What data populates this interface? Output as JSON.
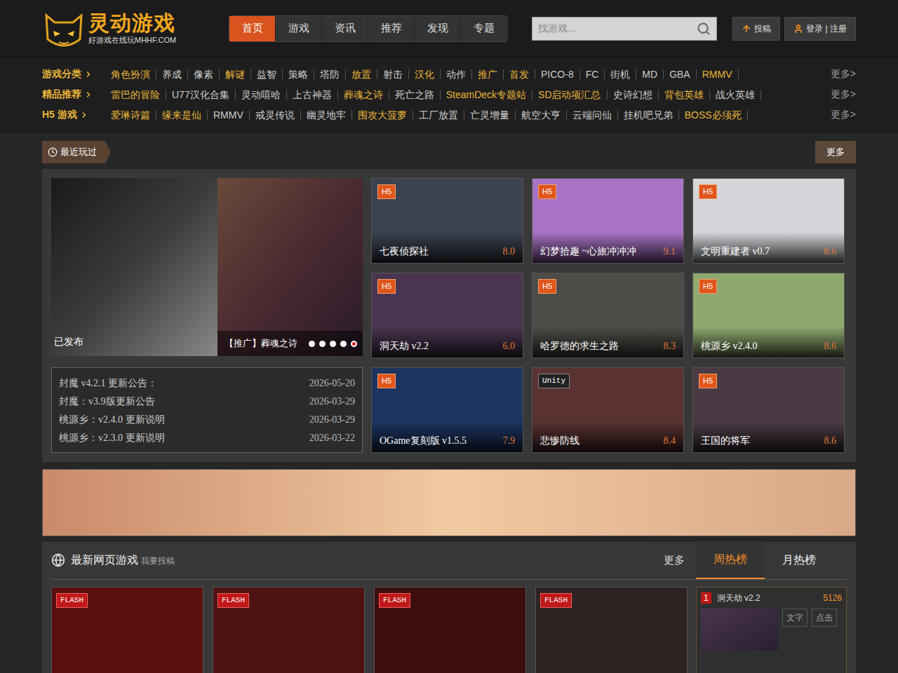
{
  "header": {
    "logo": {
      "title": "灵动游戏",
      "subtitle": "好游戏在线玩MHHF.COM"
    },
    "nav": [
      {
        "label": "首页",
        "selected": true
      },
      {
        "label": "游戏",
        "selected": false
      },
      {
        "label": "资讯",
        "selected": false
      },
      {
        "label": "推荐",
        "selected": false
      },
      {
        "label": "发现",
        "selected": false
      },
      {
        "label": "专题",
        "selected": false
      }
    ],
    "search": {
      "placeholder": "找游戏..."
    },
    "actions": [
      {
        "label": "投稿",
        "kind": "submit"
      },
      {
        "label": "登录 | 注册",
        "kind": "login"
      }
    ]
  },
  "categories": [
    {
      "label": "游戏分类",
      "more": "更多>",
      "items": [
        {
          "label": "角色扮演",
          "color": "#e8b53a"
        },
        {
          "label": "养成",
          "color": "#cccccc"
        },
        {
          "label": "像素",
          "color": "#cccccc"
        },
        {
          "label": "解谜",
          "color": "#e8b53a"
        },
        {
          "label": "益智",
          "color": "#cccccc"
        },
        {
          "label": "策略",
          "color": "#cccccc"
        },
        {
          "label": "塔防",
          "color": "#cccccc"
        },
        {
          "label": "放置",
          "color": "#e8b53a"
        },
        {
          "label": "射击",
          "color": "#cccccc"
        },
        {
          "label": "汉化",
          "color": "#e8b53a"
        },
        {
          "label": "动作",
          "color": "#cccccc"
        },
        {
          "label": "推广",
          "color": "#e8b53a"
        },
        {
          "label": "首发",
          "color": "#e8b53a"
        },
        {
          "label": "PICO-8",
          "color": "#cccccc"
        },
        {
          "label": "FC",
          "color": "#cccccc"
        },
        {
          "label": "街机",
          "color": "#cccccc"
        },
        {
          "label": "MD",
          "color": "#cccccc"
        },
        {
          "label": "GBA",
          "color": "#cccccc"
        },
        {
          "label": "RMMV",
          "color": "#e8b53a"
        }
      ]
    },
    {
      "label": "精品推荐",
      "more": "更多>",
      "items": [
        {
          "label": "雷巴的冒险",
          "color": "#e8b53a"
        },
        {
          "label": "U77汉化合集",
          "color": "#cccccc"
        },
        {
          "label": "灵动嘻哈",
          "color": "#cccccc"
        },
        {
          "label": "上古神器",
          "color": "#cccccc"
        },
        {
          "label": "葬魂之诗",
          "color": "#e8b53a"
        },
        {
          "label": "死亡之路",
          "color": "#cccccc"
        },
        {
          "label": "SteamDeck专题站",
          "color": "#e8b53a"
        },
        {
          "label": "SD启动项汇总",
          "color": "#e8b53a"
        },
        {
          "label": "史诗幻想",
          "color": "#cccccc"
        },
        {
          "label": "背包英雄",
          "color": "#e8b53a"
        },
        {
          "label": "战火英雄",
          "color": "#cccccc"
        }
      ]
    },
    {
      "label": "H5 游戏",
      "more": "更多>",
      "items": [
        {
          "label": "爱琳诗篇",
          "color": "#e8b53a"
        },
        {
          "label": "缘来是仙",
          "color": "#e8b53a"
        },
        {
          "label": "RMMV",
          "color": "#cccccc"
        },
        {
          "label": "戒灵传说",
          "color": "#cccccc"
        },
        {
          "label": "幽灵地牢",
          "color": "#cccccc"
        },
        {
          "label": "围攻大菠萝",
          "color": "#e8b53a"
        },
        {
          "label": "工厂放置",
          "color": "#cccccc"
        },
        {
          "label": "亡灵增量",
          "color": "#cccccc"
        },
        {
          "label": "航空大亨",
          "color": "#cccccc"
        },
        {
          "label": "云端问仙",
          "color": "#cccccc"
        },
        {
          "label": "挂机吧兄弟",
          "color": "#cccccc"
        },
        {
          "label": "BOSS必须死",
          "color": "#e8b53a"
        }
      ]
    }
  ],
  "recent": {
    "title": "最近玩过",
    "more": "更多",
    "carousel": {
      "captions": [
        "已发布",
        "【推广】葬魂之诗"
      ],
      "dots": [
        {
          "selected": false
        },
        {
          "selected": false
        },
        {
          "selected": false
        },
        {
          "selected": false
        },
        {
          "selected": true
        }
      ]
    },
    "news": [
      {
        "title": "封魔 v4.2.1 更新公告：",
        "date": "2026-05-20"
      },
      {
        "title": "封魔：v3.9版更新公告",
        "date": "2026-03-29"
      },
      {
        "title": "桃源乡：v2.4.0 更新说明",
        "date": "2026-03-29"
      },
      {
        "title": "桃源乡：v2.3.0 更新说明",
        "date": "2026-03-22"
      }
    ],
    "games": [
      {
        "title": "七夜侦探社",
        "score": "8.0",
        "badge": "H5",
        "kind": "h5"
      },
      {
        "title": "幻梦拾趣 ~心旅冲冲冲",
        "score": "9.1",
        "badge": "H5",
        "kind": "h5"
      },
      {
        "title": "文明重建者 v0.7",
        "score": "8.6",
        "badge": "H5",
        "kind": "h5"
      },
      {
        "title": "洞天劫 v2.2",
        "score": "6.0",
        "badge": "H5",
        "kind": "h5"
      },
      {
        "title": "哈罗德的求生之路",
        "score": "8.3",
        "badge": "H5",
        "kind": "h5"
      },
      {
        "title": "桃源乡 v2.4.0",
        "score": "8.6",
        "badge": "H5",
        "kind": "h5"
      },
      {
        "title": "OGame复刻版 v1.5.5",
        "score": "7.9",
        "badge": "H5",
        "kind": "h5"
      },
      {
        "title": "悲惨防线",
        "score": "8.4",
        "badge": "Unity",
        "kind": "unity"
      },
      {
        "title": "王国的将军",
        "score": "8.6",
        "badge": "H5",
        "kind": "h5"
      }
    ]
  },
  "latest": {
    "title": "最新网页游戏",
    "submit": "我要投稿",
    "more": "更多",
    "tabs": [
      {
        "label": "周热榜",
        "selected": true
      },
      {
        "label": "月热榜",
        "selected": false
      }
    ],
    "games": [
      {
        "badge": "FLASH"
      },
      {
        "badge": "FLASH"
      },
      {
        "badge": "FLASH"
      },
      {
        "badge": "FLASH"
      }
    ],
    "ranking": [
      {
        "rank": "1",
        "title": "洞天劫 v2.2",
        "count": "5126",
        "buttons": [
          "文字",
          "点击"
        ]
      }
    ]
  }
}
